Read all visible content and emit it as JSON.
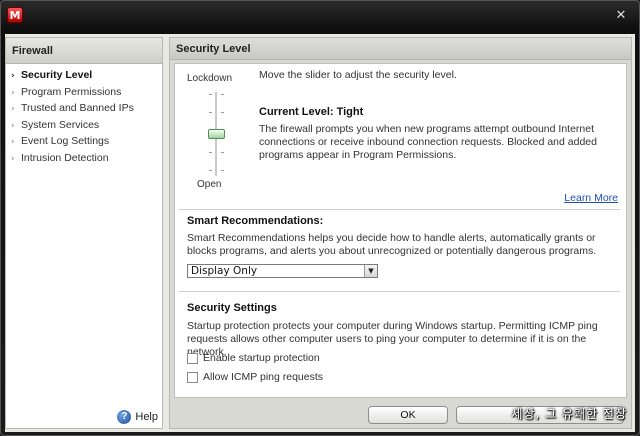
{
  "window": {
    "logo_letter": "M",
    "close_glyph": "✕"
  },
  "sidebar": {
    "title": "Firewall",
    "items": [
      {
        "label": "Security Level",
        "active": true
      },
      {
        "label": "Program Permissions",
        "active": false
      },
      {
        "label": "Trusted and Banned IPs",
        "active": false
      },
      {
        "label": "System Services",
        "active": false
      },
      {
        "label": "Event Log Settings",
        "active": false
      },
      {
        "label": "Intrusion Detection",
        "active": false
      }
    ],
    "help_label": "Help",
    "help_icon": "?"
  },
  "main": {
    "title": "Security Level",
    "slider": {
      "top_label": "Lockdown",
      "bottom_label": "Open",
      "level_fraction_from_bottom": 0.5
    },
    "instruction": "Move the slider to adjust the security level.",
    "current_level_label": "Current Level:",
    "current_level_value": "Tight",
    "level_description": "The firewall prompts you when new programs attempt outbound Internet connections or receive inbound connection requests. Blocked and added programs appear in Program Permissions.",
    "learn_more": "Learn More",
    "smart": {
      "title": "Smart Recommendations:",
      "description": "Smart Recommendations helps you decide how to handle alerts, automatically grants or blocks programs, and alerts you about unrecognized or potentially dangerous programs.",
      "selected": "Display Only"
    },
    "security_settings": {
      "title": "Security Settings",
      "description": "Startup protection protects your computer during Windows startup. Permitting ICMP ping requests allows other computer users to ping your computer to determine if it is on the network.",
      "options": [
        {
          "label": "Enable startup protection",
          "checked": false
        },
        {
          "label": "Allow ICMP ping requests",
          "checked": false
        }
      ]
    }
  },
  "footer": {
    "ok_label": "OK",
    "watermark": "세상, 그 유쾌한 전장"
  },
  "colors": {
    "accent_link": "#1d4fb5",
    "logo_red": "#d40000",
    "thumb_green": "#9fd49f"
  }
}
